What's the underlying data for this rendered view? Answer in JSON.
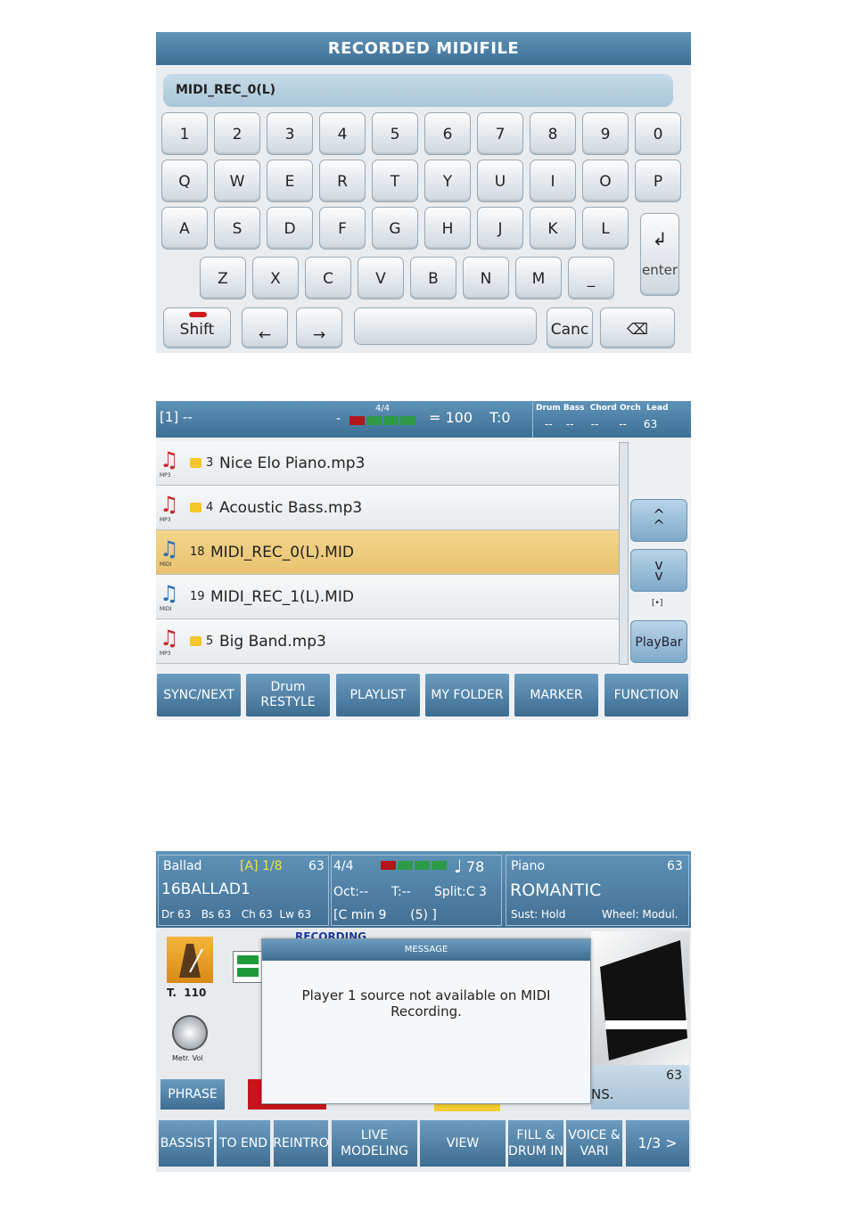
{
  "keyboard": {
    "title": "RECORDED MIDIFILE",
    "field_value": "MIDI_REC_0(L)",
    "row1": [
      "1",
      "2",
      "3",
      "4",
      "5",
      "6",
      "7",
      "8",
      "9",
      "0"
    ],
    "row2": [
      "Q",
      "W",
      "E",
      "R",
      "T",
      "Y",
      "U",
      "I",
      "O",
      "P"
    ],
    "row3": [
      "A",
      "S",
      "D",
      "F",
      "G",
      "H",
      "J",
      "K",
      "L"
    ],
    "row4": [
      "Z",
      "X",
      "C",
      "V",
      "B",
      "N",
      "M",
      "_"
    ],
    "enter_symbol": "↲",
    "enter_label": "enter",
    "shift_label": "Shift",
    "left_arrow": "←",
    "right_arrow": "→",
    "cancel_label": "Canc",
    "backspace_symbol": "⌫"
  },
  "player": {
    "slot": "[1] --",
    "dash": "-",
    "time_sig": "4/4",
    "tempo": "= 100",
    "transpose": "T:0",
    "track_labels": "Drum Bass  Chord Orch  Lead",
    "track_values": "--    --     --      --     63",
    "files": [
      {
        "type": "MP3",
        "num": "3",
        "name": "Nice Elo Piano.mp3",
        "folder": true
      },
      {
        "type": "MP3",
        "num": "4",
        "name": "Acoustic Bass.mp3",
        "folder": true
      },
      {
        "type": "MIDI",
        "num": "18",
        "name": "MIDI_REC_0(L).MID",
        "folder": false,
        "selected": true
      },
      {
        "type": "MIDI",
        "num": "19",
        "name": "MIDI_REC_1(L).MID",
        "folder": false
      },
      {
        "type": "MP3",
        "num": "5",
        "name": "Big Band.mp3",
        "folder": true
      }
    ],
    "scroll_up": "^\n^",
    "scroll_down": "v\nv",
    "small_icon": "[•]",
    "playbar": "PlayBar",
    "bottom": [
      "SYNC/NEXT",
      "Drum\nRESTYLE",
      "PLAYLIST",
      "MY FOLDER",
      "MARKER",
      "FUNCTION"
    ]
  },
  "recording": {
    "style_name": "Ballad",
    "section": "[A] 1/8",
    "style_vol": "63",
    "style_id": "16BALLAD1",
    "style_vols": "Dr 63   Bs 63   Ch 63  Lw 63",
    "time_sig": "4/4",
    "tempo_num": "78",
    "oct": "Oct:--",
    "trans": "T:--",
    "split": "Split:C 3",
    "chord": "[C min 9      (5) ]",
    "voice_family": "Piano",
    "voice_vol": "63",
    "voice_name": "ROMANTIC",
    "sust": "Sust: Hold",
    "wheel": "Wheel: Modul.",
    "recording_label": "RECORDING",
    "tempo_label": "T.  110",
    "metro_label": "Metr. Vol",
    "right_vol": "63",
    "right_text": "NS.",
    "phrase": "PHRASE",
    "message_title": "MESSAGE",
    "message_text": "Player 1 source not available on MIDI Recording.",
    "bottom": [
      "BASSIST",
      "TO END",
      "REINTRO",
      "LIVE\nMODELING",
      "VIEW",
      "FILL &\nDRUM IN",
      "VOICE &\nVARI",
      "1/3 >"
    ]
  }
}
